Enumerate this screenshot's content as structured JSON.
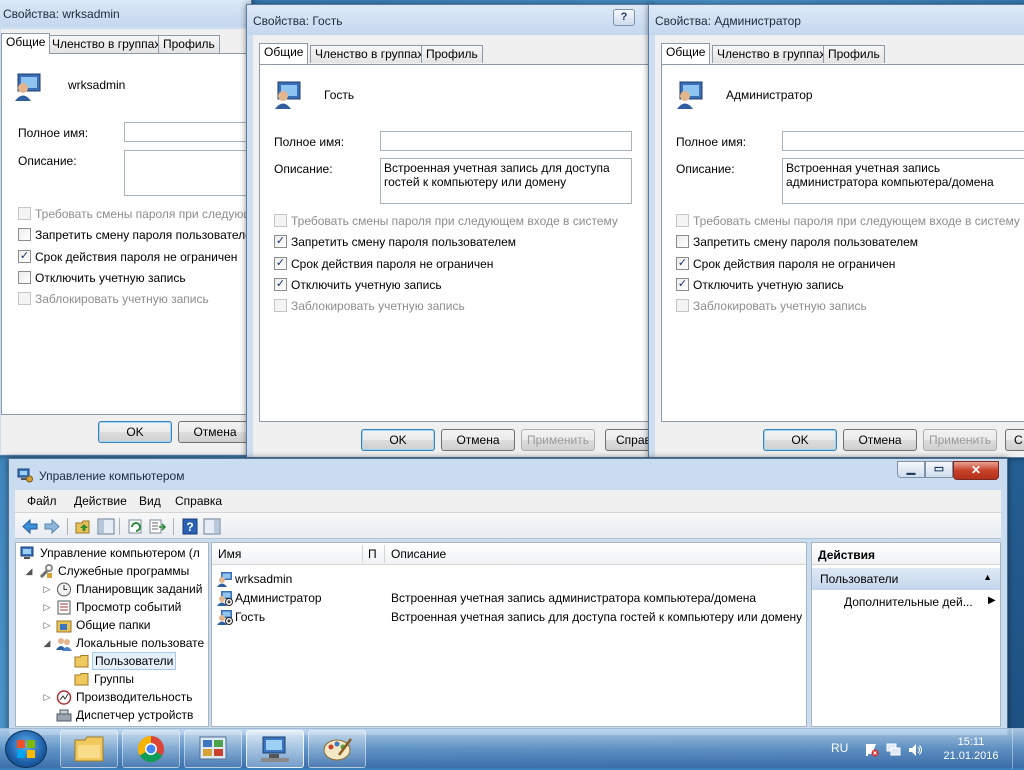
{
  "dialog1": {
    "title": "Свойства: wrksadmin",
    "tabs": [
      "Общие",
      "Членство в группах",
      "Профиль"
    ],
    "username": "wrksadmin",
    "fullname_label": "Полное имя:",
    "fullname_value": "",
    "desc_label": "Описание:",
    "desc_value": "",
    "checkboxes": [
      {
        "label": "Требовать смены пароля при следующем",
        "checked": false,
        "disabled": true
      },
      {
        "label": "Запретить смену пароля пользователем",
        "checked": false,
        "disabled": false
      },
      {
        "label": "Срок действия пароля не ограничен",
        "checked": true,
        "disabled": false
      },
      {
        "label": "Отключить учетную запись",
        "checked": false,
        "disabled": false
      },
      {
        "label": "Заблокировать учетную запись",
        "checked": false,
        "disabled": true
      }
    ],
    "ok": "OK",
    "cancel": "Отмена"
  },
  "dialog2": {
    "title": "Свойства: Гость",
    "tabs": [
      "Общие",
      "Членство в группах",
      "Профиль"
    ],
    "username": "Гость",
    "fullname_label": "Полное имя:",
    "fullname_value": "",
    "desc_label": "Описание:",
    "desc_value": "Встроенная учетная запись для доступа гостей к компьютеру или домену",
    "checkboxes": [
      {
        "label": "Требовать смены пароля при следующем входе в систему",
        "checked": false,
        "disabled": true
      },
      {
        "label": "Запретить смену пароля пользователем",
        "checked": true,
        "disabled": false
      },
      {
        "label": "Срок действия пароля не ограничен",
        "checked": true,
        "disabled": false
      },
      {
        "label": "Отключить учетную запись",
        "checked": true,
        "disabled": false
      },
      {
        "label": "Заблокировать учетную запись",
        "checked": false,
        "disabled": true
      }
    ],
    "ok": "OK",
    "cancel": "Отмена",
    "apply": "Применить",
    "help": "Справ",
    "help_btn": "?",
    "close_btn": "X"
  },
  "dialog3": {
    "title": "Свойства: Администратор",
    "tabs": [
      "Общие",
      "Членство в группах",
      "Профиль"
    ],
    "username": "Администратор",
    "fullname_label": "Полное имя:",
    "fullname_value": "",
    "desc_label": "Описание:",
    "desc_value": "Встроенная учетная запись администратора компьютера/домена",
    "checkboxes": [
      {
        "label": "Требовать смены пароля при следующем входе в систему",
        "checked": false,
        "disabled": true
      },
      {
        "label": "Запретить смену пароля пользователем",
        "checked": false,
        "disabled": false
      },
      {
        "label": "Срок действия пароля не ограничен",
        "checked": true,
        "disabled": false
      },
      {
        "label": "Отключить учетную запись",
        "checked": true,
        "disabled": false
      },
      {
        "label": "Заблокировать учетную запись",
        "checked": false,
        "disabled": true
      }
    ],
    "ok": "OK",
    "cancel": "Отмена",
    "apply": "Применить",
    "help": "С"
  },
  "main": {
    "title": "Управление компьютером",
    "menu": [
      "Файл",
      "Действие",
      "Вид",
      "Справка"
    ],
    "tree": [
      {
        "label": "Управление компьютером (л",
        "indent": 0,
        "arrow": "",
        "icon": "computer-icon"
      },
      {
        "label": "Служебные программы",
        "indent": 1,
        "arrow": "◢",
        "icon": "tools-icon"
      },
      {
        "label": "Планировщик заданий",
        "indent": 2,
        "arrow": "▷",
        "icon": "clock-icon"
      },
      {
        "label": "Просмотр событий",
        "indent": 2,
        "arrow": "▷",
        "icon": "event-viewer-icon"
      },
      {
        "label": "Общие папки",
        "indent": 2,
        "arrow": "▷",
        "icon": "shared-folder-icon"
      },
      {
        "label": "Локальные пользовате",
        "indent": 2,
        "arrow": "◢",
        "icon": "users-icon"
      },
      {
        "label": "Пользователи",
        "indent": 3,
        "arrow": "",
        "icon": "folder-icon",
        "selected": true
      },
      {
        "label": "Группы",
        "indent": 3,
        "arrow": "",
        "icon": "folder-icon"
      },
      {
        "label": "Производительность",
        "indent": 2,
        "arrow": "▷",
        "icon": "performance-icon"
      },
      {
        "label": "Диспетчер устройств",
        "indent": 2,
        "arrow": "",
        "icon": "device-manager-icon"
      }
    ],
    "columns": [
      "Имя",
      "П",
      "Описание"
    ],
    "rows": [
      {
        "name": "wrksadmin",
        "desc": "",
        "icon": "user-icon"
      },
      {
        "name": "Администратор",
        "desc": "Встроенная учетная запись администратора компьютера/домена",
        "icon": "user-disabled-icon"
      },
      {
        "name": "Гость",
        "desc": "Встроенная учетная запись для доступа гостей к компьютеру или домену",
        "icon": "user-disabled-icon"
      }
    ],
    "actions_header": "Действия",
    "actions_section": "Пользователи",
    "actions_more": "Дополнительные дей..."
  },
  "taskbar": {
    "lang": "RU",
    "time": "15:11",
    "date": "21.01.2016"
  }
}
